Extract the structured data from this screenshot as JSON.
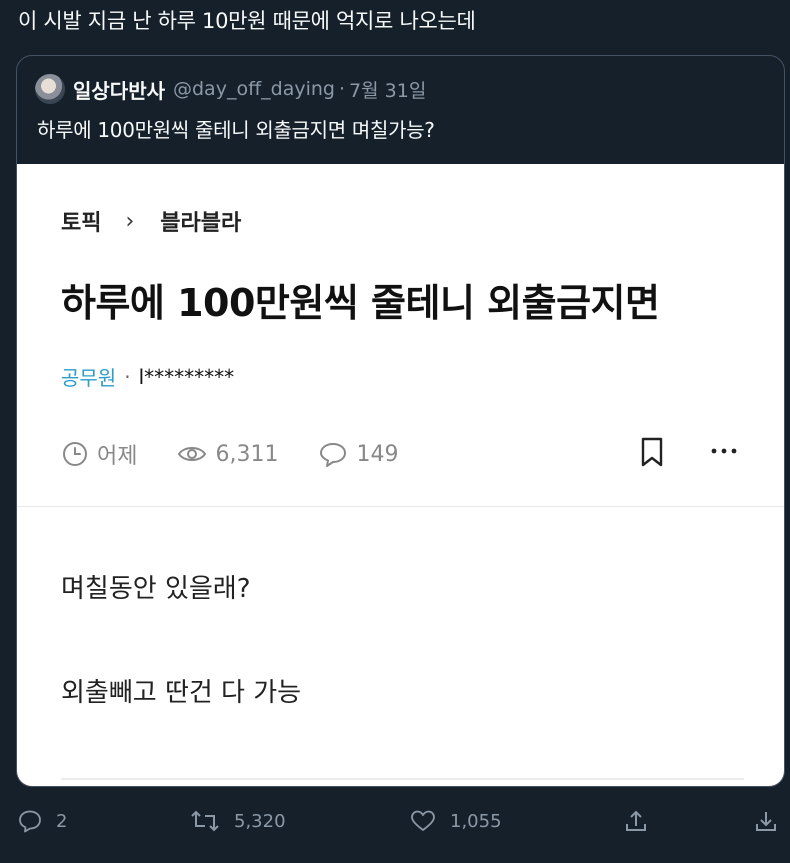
{
  "tweet": {
    "text": "이 시발 지금 난 하루 10만원 때문에 억지로 나오는데"
  },
  "quote": {
    "name": "일상다반사",
    "handle": "@day_off_daying",
    "date": "7월 31일",
    "text": "하루에 100만원씩 줄테니 외출금지면 며칠가능?"
  },
  "post": {
    "breadcrumb_topic": "토픽",
    "breadcrumb_sep": "›",
    "breadcrumb_board": "블라블라",
    "title": "하루에 100만원씩 줄테니 외출금지면",
    "author_company": "공무원",
    "author_dot": "·",
    "author_id": "l*********",
    "time": "어제",
    "views": "6,311",
    "comments": "149",
    "body_line1": "며칠동안 있을래?",
    "body_line2": "외출빼고 딴건 다 가능"
  },
  "actions": {
    "replies": "2",
    "retweets": "5,320",
    "likes": "1,055"
  },
  "icons": {
    "clock": "clock-icon",
    "eye": "eye-icon",
    "comment": "comment-icon",
    "bookmark": "bookmark-icon",
    "more": "more-icon",
    "reply": "reply-icon",
    "retweet": "retweet-icon",
    "like": "heart-icon",
    "share": "share-icon",
    "download": "download-icon"
  },
  "colors": {
    "background": "#15202b",
    "text": "#f7f9f9",
    "muted": "#8b98a5",
    "company_link": "#2b9dc6"
  }
}
